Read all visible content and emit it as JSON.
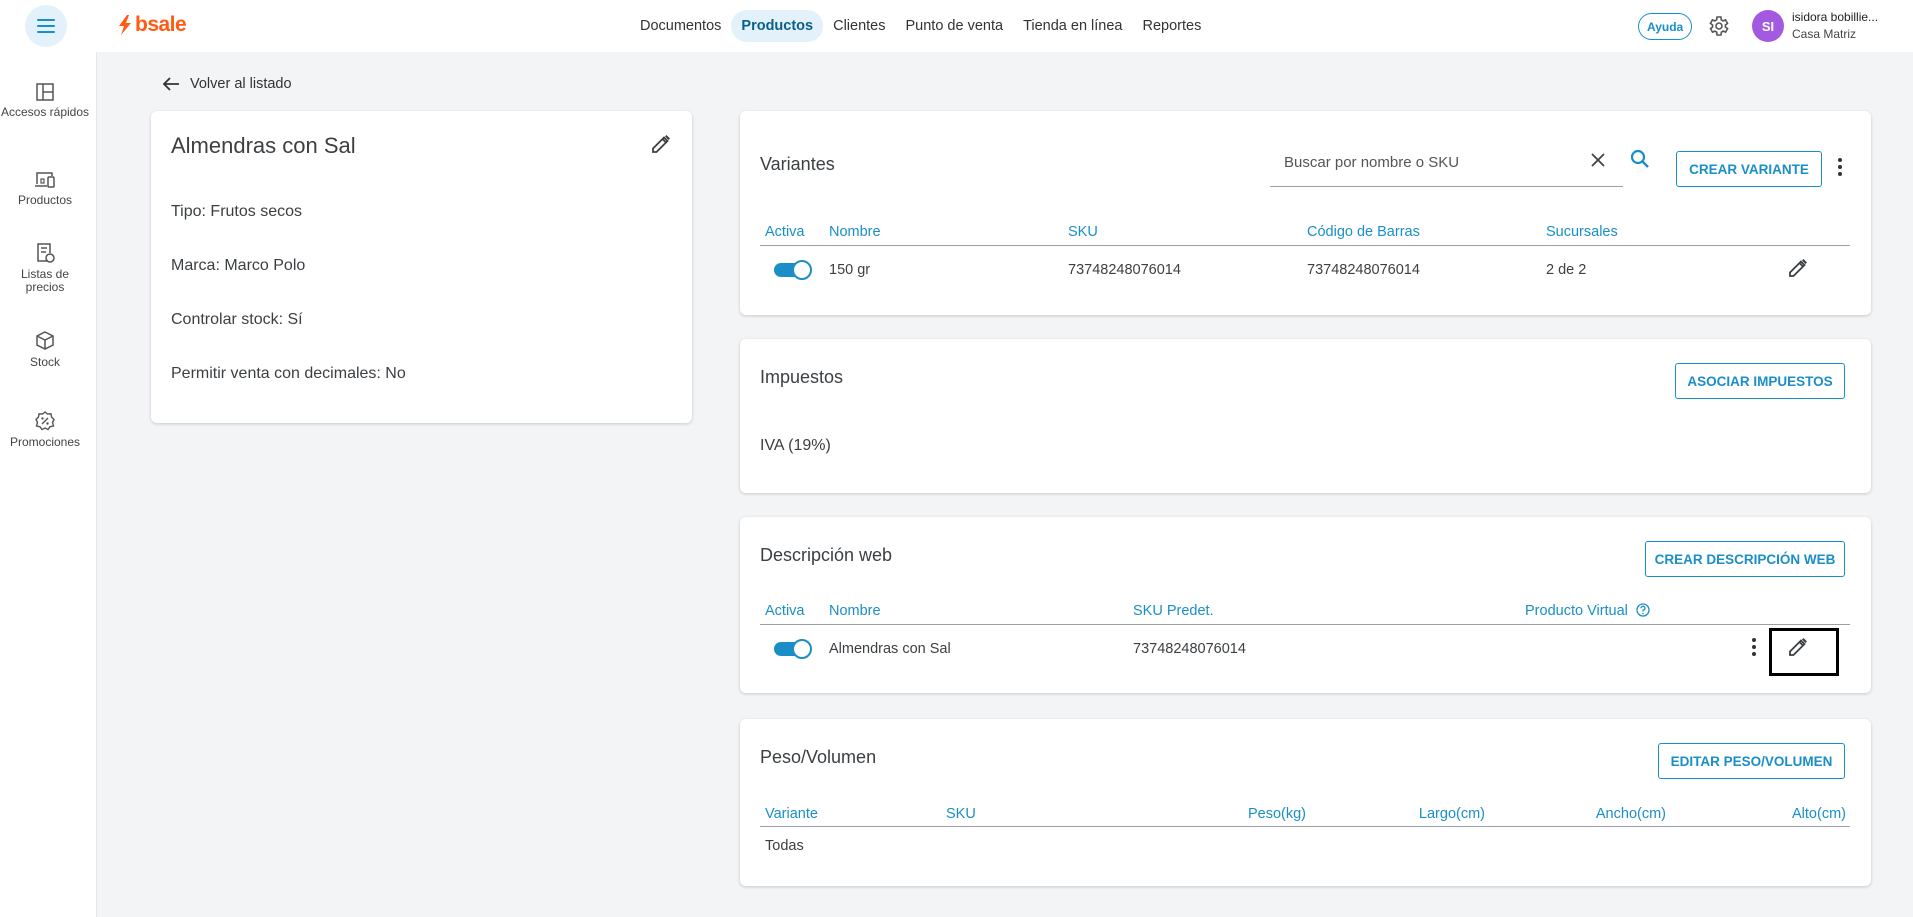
{
  "header": {
    "logo_text": "bsale",
    "nav": [
      "Documentos",
      "Productos",
      "Clientes",
      "Punto de venta",
      "Tienda en línea",
      "Reportes"
    ],
    "active_nav": "Productos",
    "help_label": "Ayuda",
    "avatar_initials": "SI",
    "user_name": "isidora bobillie...",
    "branch": "Casa Matriz"
  },
  "sidebar": {
    "items": [
      {
        "label": "Accesos rápidos",
        "icon": "dashboard-icon"
      },
      {
        "label": "Productos",
        "icon": "products-icon"
      },
      {
        "label": "Listas de precios",
        "icon": "price-list-icon"
      },
      {
        "label": "Stock",
        "icon": "box-icon"
      },
      {
        "label": "Promociones",
        "icon": "promo-icon"
      }
    ]
  },
  "back_label": "Volver al listado",
  "product": {
    "name": "Almendras con Sal",
    "lines": [
      "Tipo: Frutos secos",
      "Marca: Marco Polo",
      "Controlar stock: Sí",
      "Permitir venta con decimales: No"
    ]
  },
  "variants": {
    "title": "Variantes",
    "search_placeholder": "Buscar por nombre o SKU",
    "create_label": "CREAR VARIANTE",
    "columns": [
      "Activa",
      "Nombre",
      "SKU",
      "Código de Barras",
      "Sucursales"
    ],
    "rows": [
      {
        "active": true,
        "name": "150 gr",
        "sku": "73748248076014",
        "barcode": "73748248076014",
        "branches": "2 de 2"
      }
    ]
  },
  "taxes": {
    "title": "Impuestos",
    "button_label": "ASOCIAR IMPUESTOS",
    "items": [
      "IVA (19%)"
    ]
  },
  "web_description": {
    "title": "Descripción web",
    "button_label": "CREAR DESCRIPCIÓN WEB",
    "columns": [
      "Activa",
      "Nombre",
      "SKU Predet.",
      "Producto Virtual"
    ],
    "rows": [
      {
        "active": true,
        "name": "Almendras con Sal",
        "sku": "73748248076014"
      }
    ]
  },
  "weight_volume": {
    "title": "Peso/Volumen",
    "button_label": "EDITAR PESO/VOLUMEN",
    "columns": [
      "Variante",
      "SKU",
      "Peso(kg)",
      "Largo(cm)",
      "Ancho(cm)",
      "Alto(cm)"
    ],
    "rows": [
      {
        "variant": "Todas"
      }
    ]
  },
  "colors": {
    "accent": "#1a8fc7",
    "brand": "#ff5b14",
    "avatar": "#a35ae0"
  }
}
